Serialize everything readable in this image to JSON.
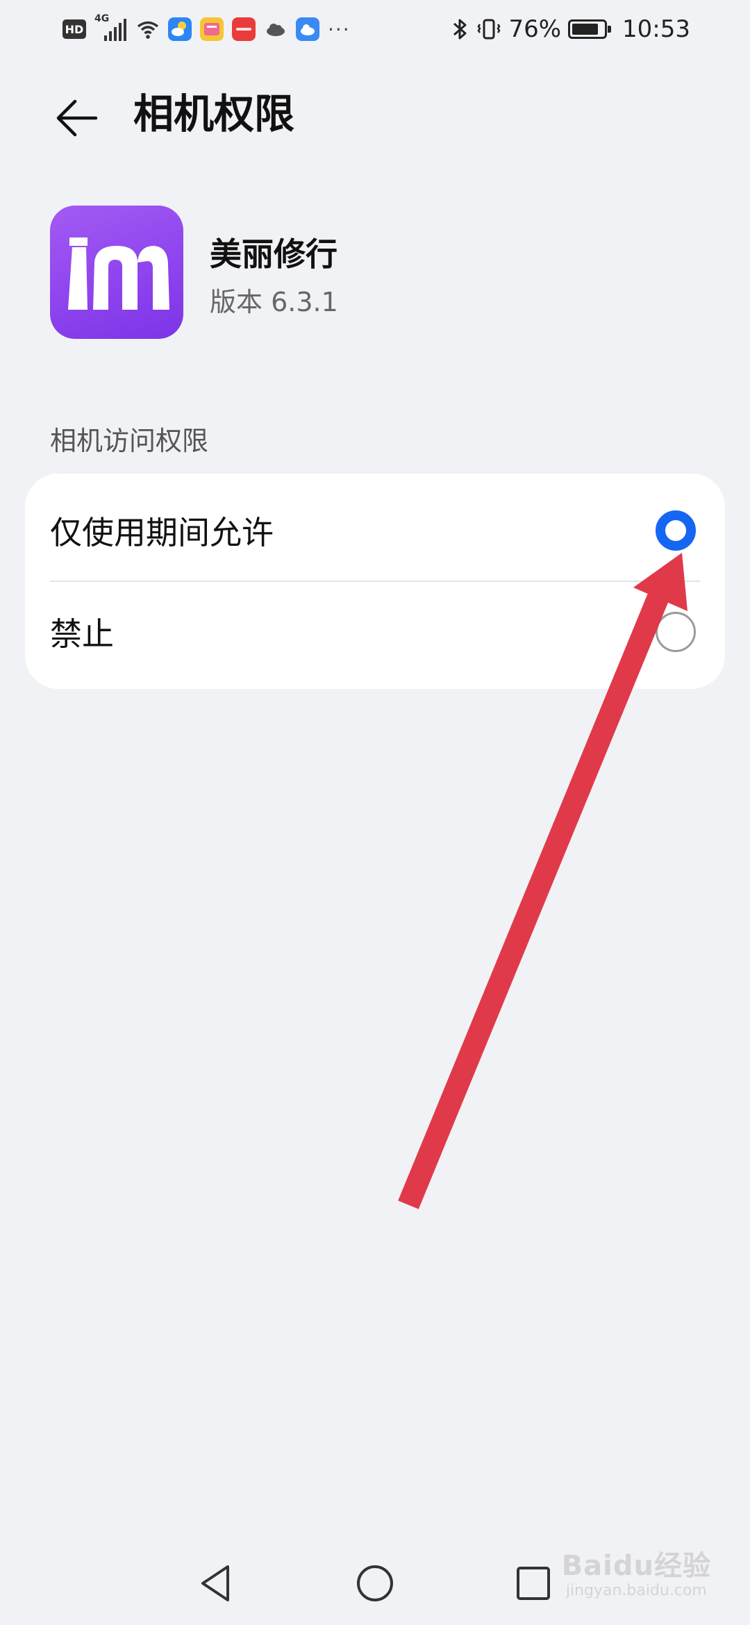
{
  "status_bar": {
    "network_label": "HD",
    "network_type": "4G",
    "icons": [
      "wifi-icon",
      "weather-app-icon",
      "notes-app-icon",
      "huawei-app-icon",
      "cloud-icon",
      "cloud-app-icon",
      "more-dots"
    ],
    "more": "···",
    "battery": "76%",
    "battery_level": 0.76,
    "time": "10:53"
  },
  "header": {
    "title": "相机权限"
  },
  "app": {
    "name": "美丽修行",
    "version": "版本 6.3.1",
    "icon_color": "#8e44ee"
  },
  "section": {
    "label": "相机访问权限",
    "options": [
      {
        "label": "仅使用期间允许",
        "selected": true
      },
      {
        "label": "禁止",
        "selected": false
      }
    ]
  },
  "accent_color": "#1567f3",
  "annotation_color": "#e03a4a",
  "watermark": {
    "brand": "Baidu经验",
    "url": "jingyan.baidu.com"
  }
}
